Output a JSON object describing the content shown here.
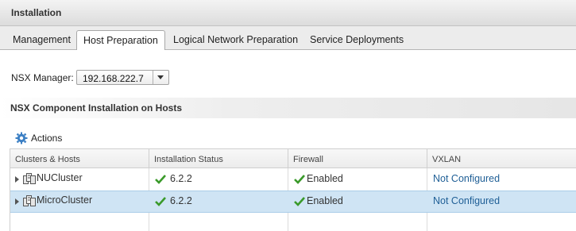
{
  "window": {
    "title": "Installation"
  },
  "tabs": [
    {
      "label": "Management",
      "active": false
    },
    {
      "label": "Host Preparation",
      "active": true
    },
    {
      "label": "Logical Network Preparation",
      "active": false
    },
    {
      "label": "Service Deployments",
      "active": false
    }
  ],
  "nsx_manager": {
    "label": "NSX Manager:",
    "value": "192.168.222.7"
  },
  "section": {
    "title": "NSX Component Installation on Hosts"
  },
  "toolbar": {
    "actions_label": "Actions",
    "actions_icon": "gear-icon"
  },
  "grid": {
    "columns": [
      "Clusters & Hosts",
      "Installation Status",
      "Firewall",
      "VXLAN"
    ],
    "rows": [
      {
        "name": "NUCluster",
        "install_status": "6.2.2",
        "firewall": "Enabled",
        "vxlan": "Not Configured",
        "selected": false
      },
      {
        "name": "MicroCluster",
        "install_status": "6.2.2",
        "firewall": "Enabled",
        "vxlan": "Not Configured",
        "selected": true
      }
    ]
  },
  "colors": {
    "check_green": "#3a9a2a",
    "link_blue": "#1f5f96",
    "selected_row": "#cfe4f4"
  }
}
